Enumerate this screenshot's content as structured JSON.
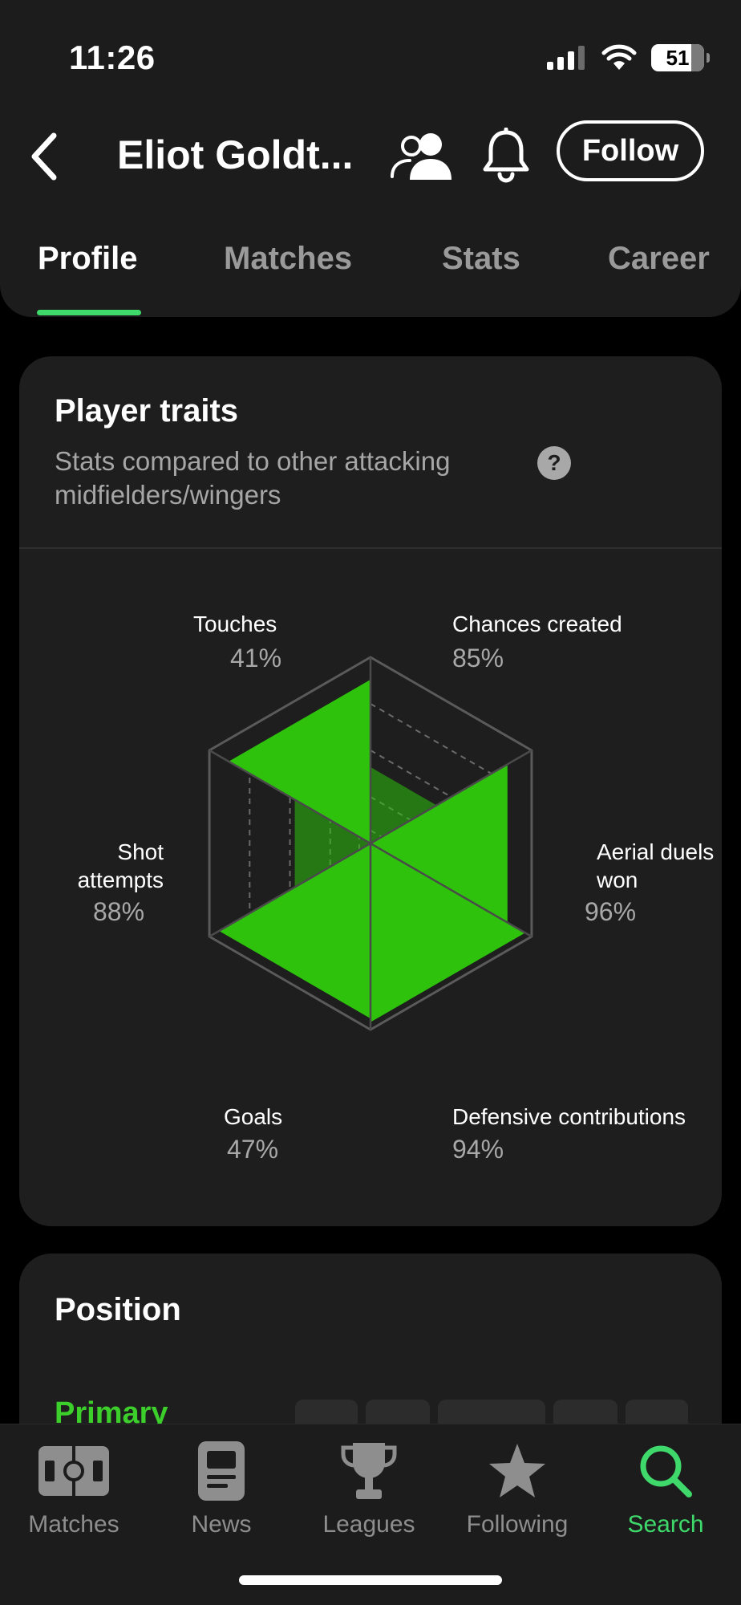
{
  "status_bar": {
    "time": "11:26",
    "battery": "51"
  },
  "header": {
    "player_name": "Eliot Goldt...",
    "follow_label": "Follow"
  },
  "tabs": [
    {
      "label": "Profile",
      "active": true
    },
    {
      "label": "Matches",
      "active": false
    },
    {
      "label": "Stats",
      "active": false
    },
    {
      "label": "Career",
      "active": false
    }
  ],
  "traits": {
    "title": "Player traits",
    "subtitle": "Stats compared to other attacking midfielders/wingers",
    "help": "?",
    "items": [
      {
        "name": "Touches",
        "value": "41%"
      },
      {
        "name": "Chances created",
        "value": "85%"
      },
      {
        "name": "Aerial duels won",
        "value": "96%"
      },
      {
        "name": "Defensive contributions",
        "value": "94%"
      },
      {
        "name": "Goals",
        "value": "47%"
      },
      {
        "name": "Shot attempts",
        "value": "88%"
      }
    ],
    "fill_color": "#2ec20d"
  },
  "position": {
    "title": "Position",
    "primary_label": "Primary"
  },
  "bottom_nav": [
    {
      "label": "Matches",
      "icon": "pitch-icon",
      "active": false
    },
    {
      "label": "News",
      "icon": "news-icon",
      "active": false
    },
    {
      "label": "Leagues",
      "icon": "trophy-icon",
      "active": false
    },
    {
      "label": "Following",
      "icon": "star-icon",
      "active": false
    },
    {
      "label": "Search",
      "icon": "search-icon",
      "active": true
    }
  ],
  "colors": {
    "accent": "#3fd96b",
    "radar_fill": "#2ec20d",
    "primary_green": "#3ccf2b"
  }
}
